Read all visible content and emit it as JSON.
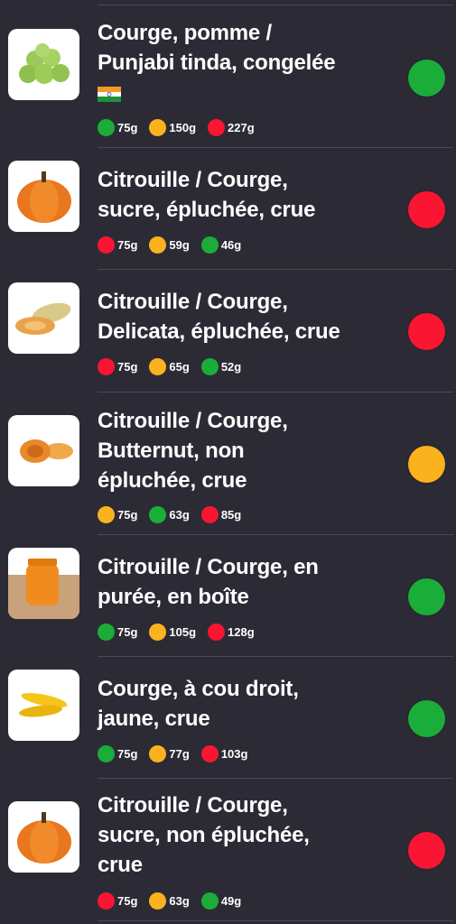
{
  "colors": {
    "green": "#1aad3a",
    "orange": "#fbb21f",
    "red": "#fa1532"
  },
  "items": [
    {
      "title": [
        "Courge, pomme /",
        "Punjabi tinda, congelée"
      ],
      "flag": "india-flag-icon",
      "image": "green-round-squash-image",
      "status": "green",
      "doses": [
        {
          "color": "green",
          "label": "75g"
        },
        {
          "color": "orange",
          "label": "150g"
        },
        {
          "color": "red",
          "label": "227g"
        }
      ]
    },
    {
      "title": [
        "Citrouille / Courge,",
        "sucre, épluchée, crue"
      ],
      "image": "pumpkin-image",
      "status": "red",
      "doses": [
        {
          "color": "red",
          "label": "75g"
        },
        {
          "color": "orange",
          "label": "59g"
        },
        {
          "color": "green",
          "label": "46g"
        }
      ]
    },
    {
      "title": [
        "Citrouille / Courge,",
        "Delicata, épluchée, crue"
      ],
      "image": "delicata-squash-image",
      "status": "red",
      "doses": [
        {
          "color": "red",
          "label": "75g"
        },
        {
          "color": "orange",
          "label": "65g"
        },
        {
          "color": "green",
          "label": "52g"
        }
      ]
    },
    {
      "title": [
        "Citrouille / Courge,",
        "Butternut, non",
        "épluchée, crue"
      ],
      "image": "butternut-squash-image",
      "status": "orange",
      "doses": [
        {
          "color": "orange",
          "label": "75g"
        },
        {
          "color": "green",
          "label": "63g"
        },
        {
          "color": "red",
          "label": "85g"
        }
      ]
    },
    {
      "title": [
        "Citrouille / Courge, en",
        "purée, en boîte"
      ],
      "image": "pumpkin-puree-jar-image",
      "status": "green",
      "doses": [
        {
          "color": "green",
          "label": "75g"
        },
        {
          "color": "orange",
          "label": "105g"
        },
        {
          "color": "red",
          "label": "128g"
        }
      ]
    },
    {
      "title": [
        "Courge, à cou droit,",
        "jaune, crue"
      ],
      "image": "yellow-squash-image",
      "status": "green",
      "doses": [
        {
          "color": "green",
          "label": "75g"
        },
        {
          "color": "orange",
          "label": "77g"
        },
        {
          "color": "red",
          "label": "103g"
        }
      ]
    },
    {
      "title": [
        "Citrouille / Courge,",
        "sucre, non épluchée,",
        "crue"
      ],
      "image": "pumpkin-image",
      "status": "red",
      "doses": [
        {
          "color": "red",
          "label": "75g"
        },
        {
          "color": "orange",
          "label": "63g"
        },
        {
          "color": "green",
          "label": "49g"
        }
      ]
    }
  ]
}
